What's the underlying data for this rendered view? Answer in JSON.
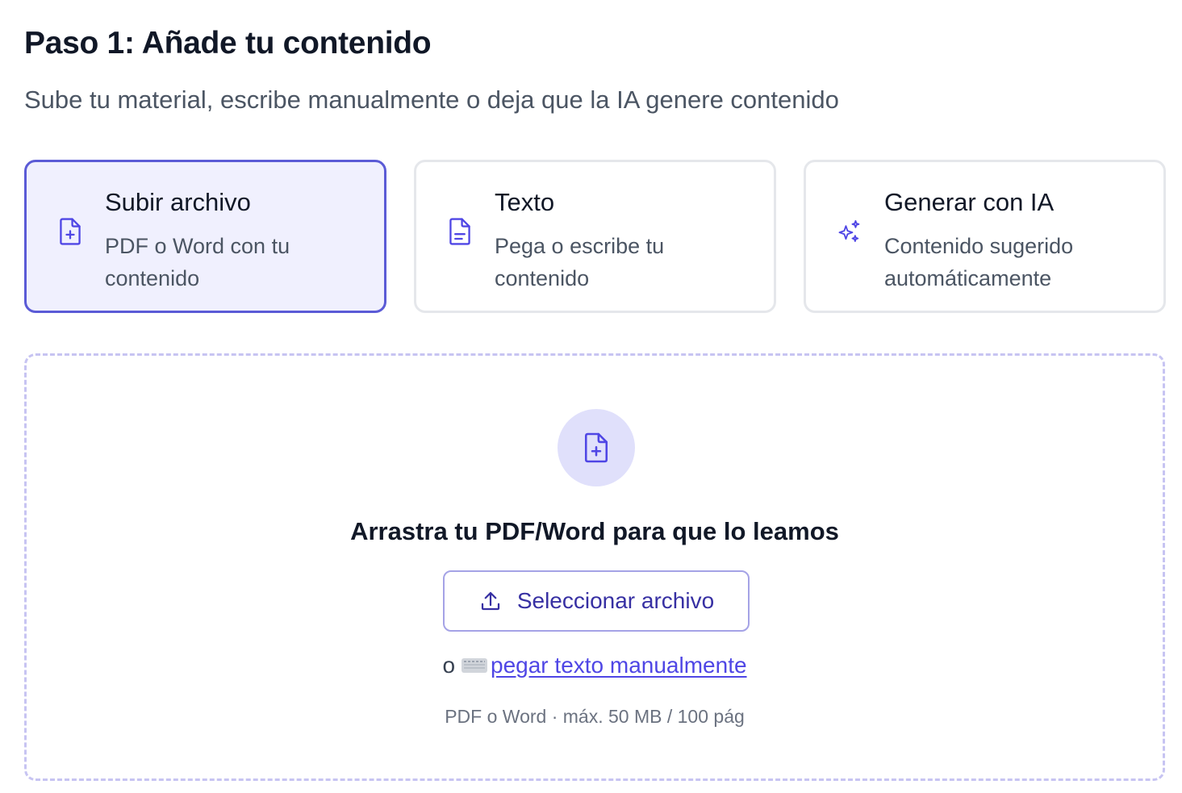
{
  "header": {
    "title": "Paso 1: Añade tu contenido",
    "subtitle": "Sube tu material, escribe manualmente o deja que la IA genere contenido"
  },
  "options": [
    {
      "title": "Subir archivo",
      "description": "PDF o Word con tu contenido",
      "icon": "file-plus-icon",
      "selected": true
    },
    {
      "title": "Texto",
      "description": "Pega o escribe tu contenido",
      "icon": "file-text-icon",
      "selected": false
    },
    {
      "title": "Generar con IA",
      "description": "Contenido sugerido automáticamente",
      "icon": "sparkles-icon",
      "selected": false
    }
  ],
  "dropzone": {
    "icon": "file-plus-icon",
    "heading": "Arrastra tu PDF/Word para que lo leamos",
    "select_button": "Seleccionar archivo",
    "select_button_icon": "upload-icon",
    "alt_prefix": "o",
    "alt_icon": "keyboard-icon",
    "alt_link": "pegar texto manualmente",
    "limits": "PDF o Word · máx. 50 MB / 100 pág"
  },
  "colors": {
    "accent": "#4f46e5",
    "selected_border": "#5b5bd6",
    "selected_bg": "#f0f0fe",
    "icon_circle_bg": "#e0e0fb",
    "dashed_border": "#c7c4f2"
  }
}
